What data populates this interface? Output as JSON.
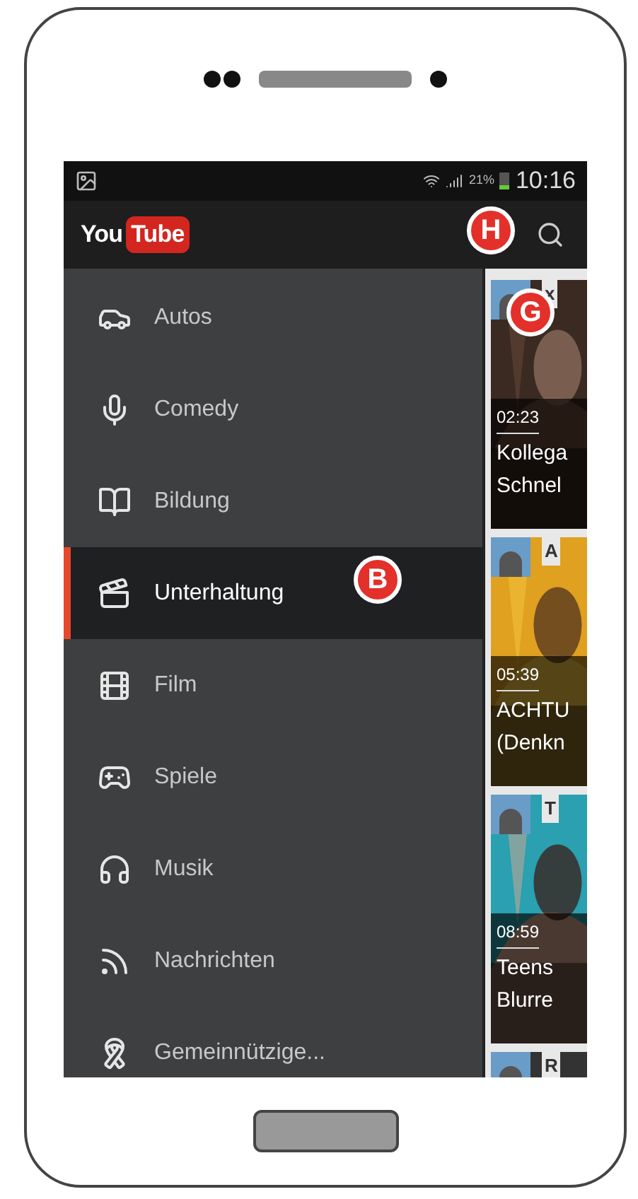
{
  "status_bar": {
    "battery": "21%",
    "time": "10:16"
  },
  "header": {
    "logo_left": "You",
    "logo_right": "Tube"
  },
  "categories": [
    {
      "label": "Autos",
      "selected": false
    },
    {
      "label": "Comedy",
      "selected": false
    },
    {
      "label": "Bildung",
      "selected": false
    },
    {
      "label": "Unterhaltung",
      "selected": true
    },
    {
      "label": "Film",
      "selected": false
    },
    {
      "label": "Spiele",
      "selected": false
    },
    {
      "label": "Musik",
      "selected": false
    },
    {
      "label": "Nachrichten",
      "selected": false
    },
    {
      "label": "Gemeinnützige..."
    }
  ],
  "videos": [
    {
      "channel": "x",
      "duration": "02:23",
      "title": [
        "Kollega",
        "Schnel"
      ]
    },
    {
      "channel": "A",
      "duration": "05:39",
      "title": [
        "ACHTU",
        "(Denkn"
      ]
    },
    {
      "channel": "T",
      "duration": "08:59",
      "title": [
        "Teens",
        "Blurre"
      ]
    },
    {
      "channel": "R"
    }
  ],
  "callouts": [
    "H",
    "G",
    "B"
  ]
}
